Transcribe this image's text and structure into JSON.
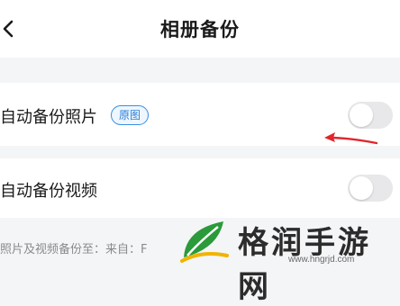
{
  "header": {
    "title": "相册备份",
    "back_icon": "chevron-left-icon"
  },
  "settings": [
    {
      "label": "自动备份照片",
      "badge": "原图",
      "toggle_on": false
    },
    {
      "label": "自动备份视频",
      "toggle_on": false
    }
  ],
  "footer": {
    "text": "照片及视频备份至：来自：F"
  },
  "annotation": {
    "arrow_color": "#e0262b"
  },
  "watermark": {
    "brand": "格润手游网",
    "url": "www.hngrjd.com"
  },
  "colors": {
    "background": "#f4f5f7",
    "badge_border": "#3a8de0",
    "toggle_off": "#e8e8ea"
  }
}
